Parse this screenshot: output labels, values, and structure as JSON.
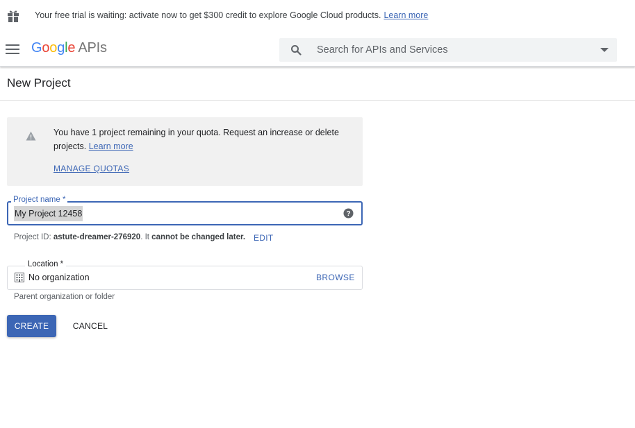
{
  "trial_banner": {
    "text": "Your free trial is waiting: activate now to get $300 credit to explore Google Cloud products.",
    "link": "Learn more",
    "icon": "gift-icon"
  },
  "header": {
    "logo_letters": [
      "G",
      "o",
      "o",
      "g",
      "l",
      "e"
    ],
    "logo_product": "APIs",
    "search_placeholder": "Search for APIs and Services"
  },
  "page": {
    "title": "New Project"
  },
  "quota_notice": {
    "text": "You have 1 project remaining in your quota. Request an increase or delete projects.",
    "link": "Learn more",
    "action": "MANAGE QUOTAS",
    "icon": "warning-icon"
  },
  "form": {
    "project_name": {
      "label": "Project name *",
      "value": "My Project 12458",
      "icon": "help-icon"
    },
    "project_id": {
      "prefix": "Project ID:",
      "id": "astute-dreamer-276920",
      "suffix_pre": ". It",
      "suffix_bold": "cannot be changed later.",
      "edit": "EDIT"
    },
    "location": {
      "label": "Location *",
      "value": "No organization",
      "browse": "BROWSE",
      "hint": "Parent organization or folder",
      "icon": "building-icon"
    }
  },
  "buttons": {
    "create": "CREATE",
    "cancel": "CANCEL"
  },
  "colors": {
    "accent": "#3c66b5",
    "notice_bg": "#f1f1f1",
    "search_bg": "#f1f3f4"
  }
}
